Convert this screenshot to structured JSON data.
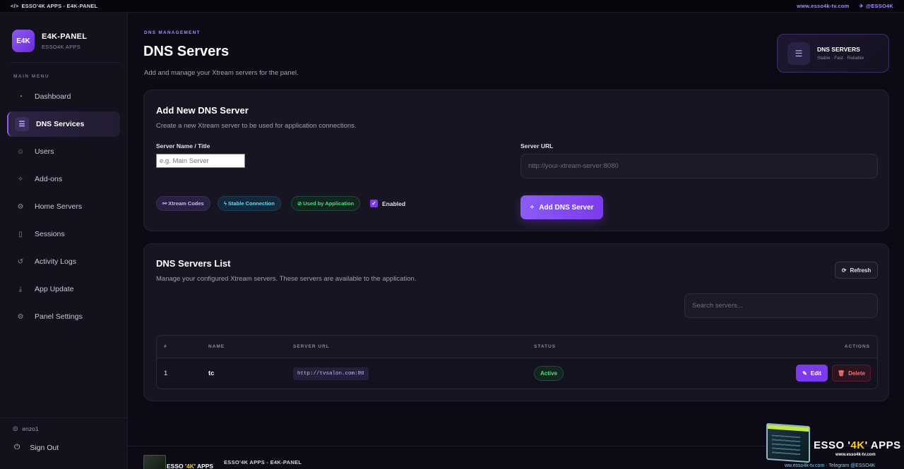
{
  "topbar": {
    "left": "ESSO'4K APPS - E4K-PANEL",
    "website": "www.esso4k-tv.com",
    "telegram": "@ESSO4K"
  },
  "brand": {
    "logo": "E4K",
    "title": "E4K-PANEL",
    "subtitle": "ESSO4K APPS"
  },
  "sidebar": {
    "heading": "MAIN MENU",
    "items": [
      {
        "label": "Dashboard",
        "icon": "gauge-icon"
      },
      {
        "label": "DNS Services",
        "icon": "server-list-icon",
        "active": true
      },
      {
        "label": "Users",
        "icon": "users-icon"
      },
      {
        "label": "Add-ons",
        "icon": "puzzle-icon"
      },
      {
        "label": "Home Servers",
        "icon": "server-icon"
      },
      {
        "label": "Sessions",
        "icon": "device-icon"
      },
      {
        "label": "Activity Logs",
        "icon": "history-icon"
      },
      {
        "label": "App Update",
        "icon": "download-icon"
      },
      {
        "label": "Panel Settings",
        "icon": "gear-icon"
      }
    ],
    "username": "enzo1",
    "signout": "Sign Out"
  },
  "header": {
    "eyebrow": "DNS MANAGEMENT",
    "title": "DNS Servers",
    "description": "Add and manage your Xtream servers for the panel.",
    "badge_title": "DNS SERVERS",
    "badge_sub": "Stable · Fast · Reliable"
  },
  "add_form": {
    "title": "Add New DNS Server",
    "description": "Create a new Xtream server to be used for application connections.",
    "name_label": "Server Name / Title",
    "name_placeholder": "e.g. Main Server",
    "url_label": "Server URL",
    "url_placeholder": "http://your-xtream-server:8080",
    "chips": [
      "Xtream Codes",
      "Stable Connection",
      "Used by Application"
    ],
    "enabled_label": "Enabled",
    "enabled": true,
    "submit_label": "Add DNS Server"
  },
  "list": {
    "title": "DNS Servers List",
    "description": "Manage your configured Xtream servers. These servers are available to the application.",
    "refresh_label": "Refresh",
    "search_placeholder": "Search servers...",
    "columns": [
      "#",
      "NAME",
      "SERVER URL",
      "STATUS",
      "ACTIONS"
    ],
    "rows": [
      {
        "num": "1",
        "name": "tc",
        "url": "http://tvsalon.com:80",
        "status": "Active"
      }
    ],
    "edit_label": "Edit",
    "delete_label": "Delete"
  },
  "footer": {
    "logo_pre": "ESSO '",
    "logo_gold": "4K",
    "logo_post": "' APPS",
    "text": "ESSO'4K APPS - E4K-PANEL"
  },
  "watermark": {
    "title_pre": "ESSO '",
    "title_gold": "4K",
    "title_post": "' APPS",
    "site": "www.esso4k-tv.com",
    "bottom": "ww.esso4k-tv.com  ·  Telegram @ESSO4K"
  },
  "colors": {
    "accent": "#8b5cf6",
    "background": "#0c0a14",
    "active_status": "#4ade80",
    "danger": "#f87171"
  }
}
